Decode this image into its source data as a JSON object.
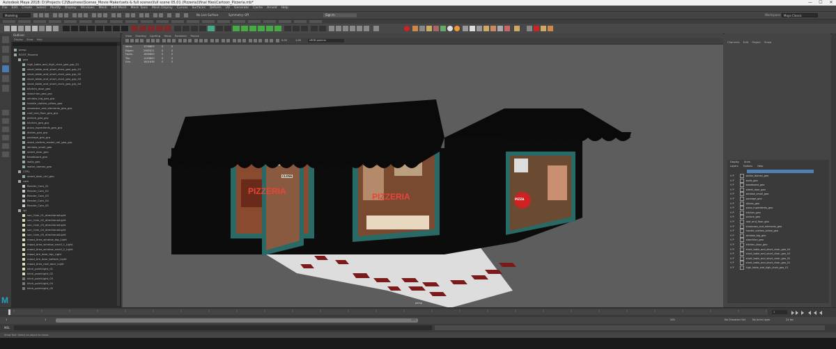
{
  "window": {
    "title": "Autodesk Maya 2018: D:\\Projects C2\\Business\\Scenes_Movie Maker\\sets & full scenes\\full scene 05.01 (Pizzeria)\\final files\\Cartoon_Pizzeria.mb*",
    "controls": [
      "—",
      "☐",
      "✕"
    ]
  },
  "menubar": [
    "File",
    "Edit",
    "Create",
    "Select",
    "Modify",
    "Display",
    "Windows",
    "Mesh",
    "Edit Mesh",
    "Mesh Tools",
    "Mesh Display",
    "Curves",
    "Surfaces",
    "Deform",
    "UV",
    "Generate",
    "Cache",
    "Arnold",
    "Help"
  ],
  "statusline": {
    "menuset": "Modeling",
    "live_surface": "No Live Surface",
    "symmetry": "Symmetry: Off",
    "signin": "Sign In",
    "workspace_label": "Workspace:",
    "workspace": "Maya Classic"
  },
  "outliner": {
    "title": "Outliner",
    "menu": [
      "Display",
      "Show",
      "Help"
    ],
    "items": [
      {
        "label": "persp",
        "indent": 0,
        "color": "#9aa"
      },
      {
        "label": "ROOT_Pizzeria",
        "indent": 0,
        "color": "#9aa"
      },
      {
        "label": "geo",
        "indent": 1,
        "color": "#9aa"
      },
      {
        "label": "high_table_and_high_chair_geo_grp_01",
        "indent": 2,
        "color": "#9aa"
      },
      {
        "label": "short_table_and_short_chair_geo_grp_01",
        "indent": 2,
        "color": "#9aa"
      },
      {
        "label": "short_table_and_short_chair_geo_grp_02",
        "indent": 2,
        "color": "#9aa"
      },
      {
        "label": "short_table_and_short_chair_geo_grp_03",
        "indent": 2,
        "color": "#9aa"
      },
      {
        "label": "short_table_and_short_chair_geo_grp_04",
        "indent": 2,
        "color": "#9aa"
      },
      {
        "label": "kitchen_door_geo",
        "indent": 2,
        "color": "#9aa"
      },
      {
        "label": "stanchion_geo_grp",
        "indent": 2,
        "color": "#9aa"
      },
      {
        "label": "window_big_geo_grp",
        "indent": 2,
        "color": "#9aa"
      },
      {
        "label": "handle_clothes_pillow_geo",
        "indent": 2,
        "color": "#9aa"
      },
      {
        "label": "showcase_and_elements_geo_grp",
        "indent": 2,
        "color": "#9aa"
      },
      {
        "label": "roof_and_floor_geo_grp",
        "indent": 2,
        "color": "#9aa"
      },
      {
        "label": "picture_geo_grp",
        "indent": 2,
        "color": "#9aa"
      },
      {
        "label": "kitchen_geo_grp",
        "indent": 2,
        "color": "#9aa"
      },
      {
        "label": "pizza_ingredients_geo_grp",
        "indent": 2,
        "color": "#9aa"
      },
      {
        "label": "dishes_geo_grp",
        "indent": 2,
        "color": "#9aa"
      },
      {
        "label": "package_geo_grp",
        "indent": 2,
        "color": "#9aa"
      },
      {
        "label": "stock_clothes_maker_roll_geo_grp",
        "indent": 2,
        "color": "#9aa"
      },
      {
        "label": "window_small_geo",
        "indent": 2,
        "color": "#9aa"
      },
      {
        "label": "street_door_geo",
        "indent": 2,
        "color": "#9aa"
      },
      {
        "label": "baseboard_geo",
        "indent": 2,
        "color": "#9aa"
      },
      {
        "label": "walls_geo",
        "indent": 2,
        "color": "#9aa"
      },
      {
        "label": "wallar_domex_geo",
        "indent": 2,
        "color": "#9aa"
      },
      {
        "label": "CTRL",
        "indent": 1,
        "color": "#9aa"
      },
      {
        "label": "street_door_ctrl_geo",
        "indent": 2,
        "color": "#9aa"
      },
      {
        "label": "cam",
        "indent": 1,
        "color": "#9aa"
      },
      {
        "label": "Render_Cam_01",
        "indent": 2,
        "color": "#ccc"
      },
      {
        "label": "Render_Cam_02",
        "indent": 2,
        "color": "#ccc"
      },
      {
        "label": "Render_Cam_03",
        "indent": 2,
        "color": "#ccc"
      },
      {
        "label": "Render_Cam_04",
        "indent": 2,
        "color": "#ccc"
      },
      {
        "label": "Render_Cam_05",
        "indent": 2,
        "color": "#ccc"
      },
      {
        "label": "lgt",
        "indent": 1,
        "color": "#9aa"
      },
      {
        "label": "sun_Cam_01_directionalLight",
        "indent": 2,
        "color": "#ddb"
      },
      {
        "label": "sun_Cam_02_directionalLight",
        "indent": 2,
        "color": "#ddb"
      },
      {
        "label": "sun_Cam_03_directionalLight",
        "indent": 2,
        "color": "#ddb"
      },
      {
        "label": "sun_Cam_04_directionalLight",
        "indent": 2,
        "color": "#ddb"
      },
      {
        "label": "sun_Cam_05_directionalLight",
        "indent": 2,
        "color": "#ddb"
      },
      {
        "label": "mood_Area_window_big_Light",
        "indent": 2,
        "color": "#ddb"
      },
      {
        "label": "mood_Area_window_small_1_Light",
        "indent": 2,
        "color": "#ddb"
      },
      {
        "label": "mood_Area_window_small_2_Light",
        "indent": 2,
        "color": "#ddb"
      },
      {
        "label": "mood_Are_door_top_Light",
        "indent": 2,
        "color": "#ddb"
      },
      {
        "label": "mood_Are_door_bottom_Light",
        "indent": 2,
        "color": "#ddb"
      },
      {
        "label": "mood_Area_roof_door_Light",
        "indent": 2,
        "color": "#ddb"
      },
      {
        "label": "kitch_pointLight_01",
        "indent": 2,
        "color": "#ddb"
      },
      {
        "label": "kitch_pointLight_02",
        "indent": 2,
        "color": "#ddb"
      },
      {
        "label": "kitch_pointLight_03",
        "indent": 2,
        "color": "#777"
      },
      {
        "label": "kitch_pointLight_04",
        "indent": 2,
        "color": "#777"
      },
      {
        "label": "kitch_pointLight_05",
        "indent": 2,
        "color": "#777"
      }
    ]
  },
  "viewport": {
    "menu": [
      "View",
      "Shading",
      "Lighting",
      "Show",
      "Renderer",
      "Panels"
    ],
    "hud": [
      {
        "label": "Verts:",
        "values": [
          "1376803",
          "0",
          "0"
        ]
      },
      {
        "label": "Edges:",
        "values": [
          "2983021",
          "0",
          "0"
        ]
      },
      {
        "label": "Faces:",
        "values": [
          "1600800",
          "0",
          "0"
        ]
      },
      {
        "label": "Tris:",
        "values": [
          "1420800",
          "0",
          "0"
        ]
      },
      {
        "label": "UVs:",
        "values": [
          "1801638",
          "0",
          "0"
        ]
      }
    ],
    "camera_label": "persp",
    "color_space": "sRGB gamma",
    "gamma_a": "0.00",
    "gamma_b": "1.00",
    "signs": {
      "pizzeria_left": "PIZZERIA",
      "pizzeria_center": "PIZZERIA",
      "open_sign": "CLOSE",
      "pizza_badge": "PIZZA"
    }
  },
  "channel_box": {
    "menu": [
      "Channels",
      "Edit",
      "Object",
      "Show"
    ],
    "layer_tabs": [
      "Display",
      "Anim"
    ],
    "layer_menu": [
      "Layers",
      "Options",
      "Help"
    ],
    "layers": [
      "wallar_domex_geo",
      "walls_geo",
      "baseboard_geo",
      "street_door_geo",
      "window_small_geo",
      "package_geo",
      "dishes_geo",
      "pizza_ingredients_geo",
      "kitchen_geo",
      "picture_geo",
      "roof_and_floor_geo",
      "showcase_and_elements_geo",
      "handle_clothes_pillow_geo",
      "window_big_geo",
      "stanchion_geo",
      "kitchen_door_geo",
      "short_table_and_short_chair_geo_04",
      "short_table_and_short_chair_geo_03",
      "short_table_and_short_chair_geo_02",
      "short_table_and_short_chair_geo_01",
      "high_table_and_high_chair_geo_01"
    ]
  },
  "timeline": {
    "start": "1",
    "end": "120",
    "range_start": "1",
    "range_end": "120",
    "anim_end": "200",
    "current_frame": "1",
    "character_set": "No Character Set",
    "anim_layer": "No Anim Layer",
    "fps": "24 fps"
  },
  "cmdline": {
    "lang": "MEL"
  },
  "helpline": {
    "text": "Show Tool: Select an object to move."
  }
}
